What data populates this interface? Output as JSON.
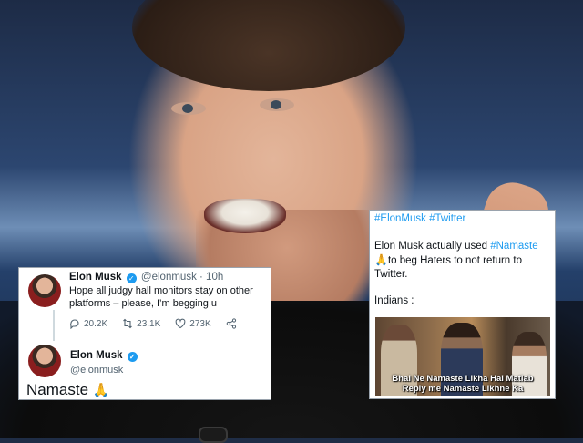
{
  "tweet": {
    "author": "Elon Musk",
    "handle": "@elonmusk",
    "time": "· 10h",
    "text": "Hope all judgy hall monitors stay on other platforms – please, I’m begging u",
    "replies": "20.2K",
    "retweets": "23.1K",
    "likes": "273K",
    "reply_author": "Elon Musk",
    "reply_handle": "@elonmusk",
    "reply_text": "Namaste",
    "reply_emoji": "🙏"
  },
  "meme": {
    "hashtags": [
      "#ElonMusk",
      "#Twitter"
    ],
    "body_before": "Elon Musk actually used",
    "body_hashtag": "#Namaste",
    "body_emoji": "🙏",
    "body_after": "to beg Haters to not return to Twitter.",
    "indians_label": "Indians :",
    "caption_line1": "Bhai Ne Namaste Likha Hai Matlab",
    "caption_line2": "Reply me Namaste Likhne Ka"
  }
}
